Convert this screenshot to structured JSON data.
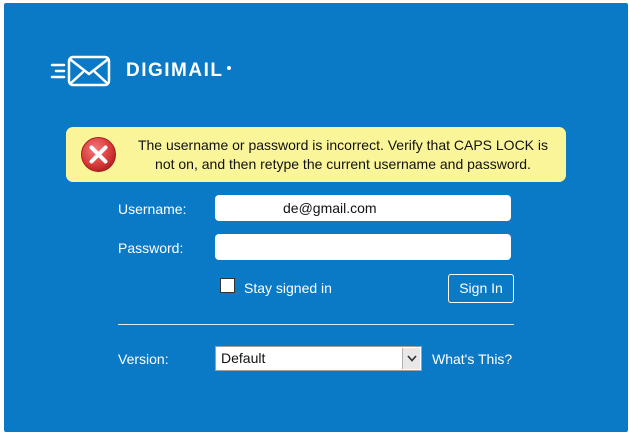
{
  "brand": {
    "name": "DIGIMAIL",
    "icon": "envelope-speed-icon"
  },
  "error": {
    "icon": "error-x-icon",
    "message": "The username or password is incorrect. Verify that CAPS LOCK is not on, and then retype the current username and password."
  },
  "form": {
    "username_label": "Username:",
    "username_value": "de@gmail.com",
    "password_label": "Password:",
    "password_value": "",
    "stay_signed_in_label": "Stay signed in",
    "stay_signed_in_checked": false,
    "sign_in_label": "Sign In"
  },
  "version": {
    "label": "Version:",
    "selected": "Default",
    "whats_this": "What's This?"
  },
  "colors": {
    "panel_bg": "#0a7ac6",
    "error_bg": "#fbf59a",
    "error_icon": "#d93b3b"
  }
}
